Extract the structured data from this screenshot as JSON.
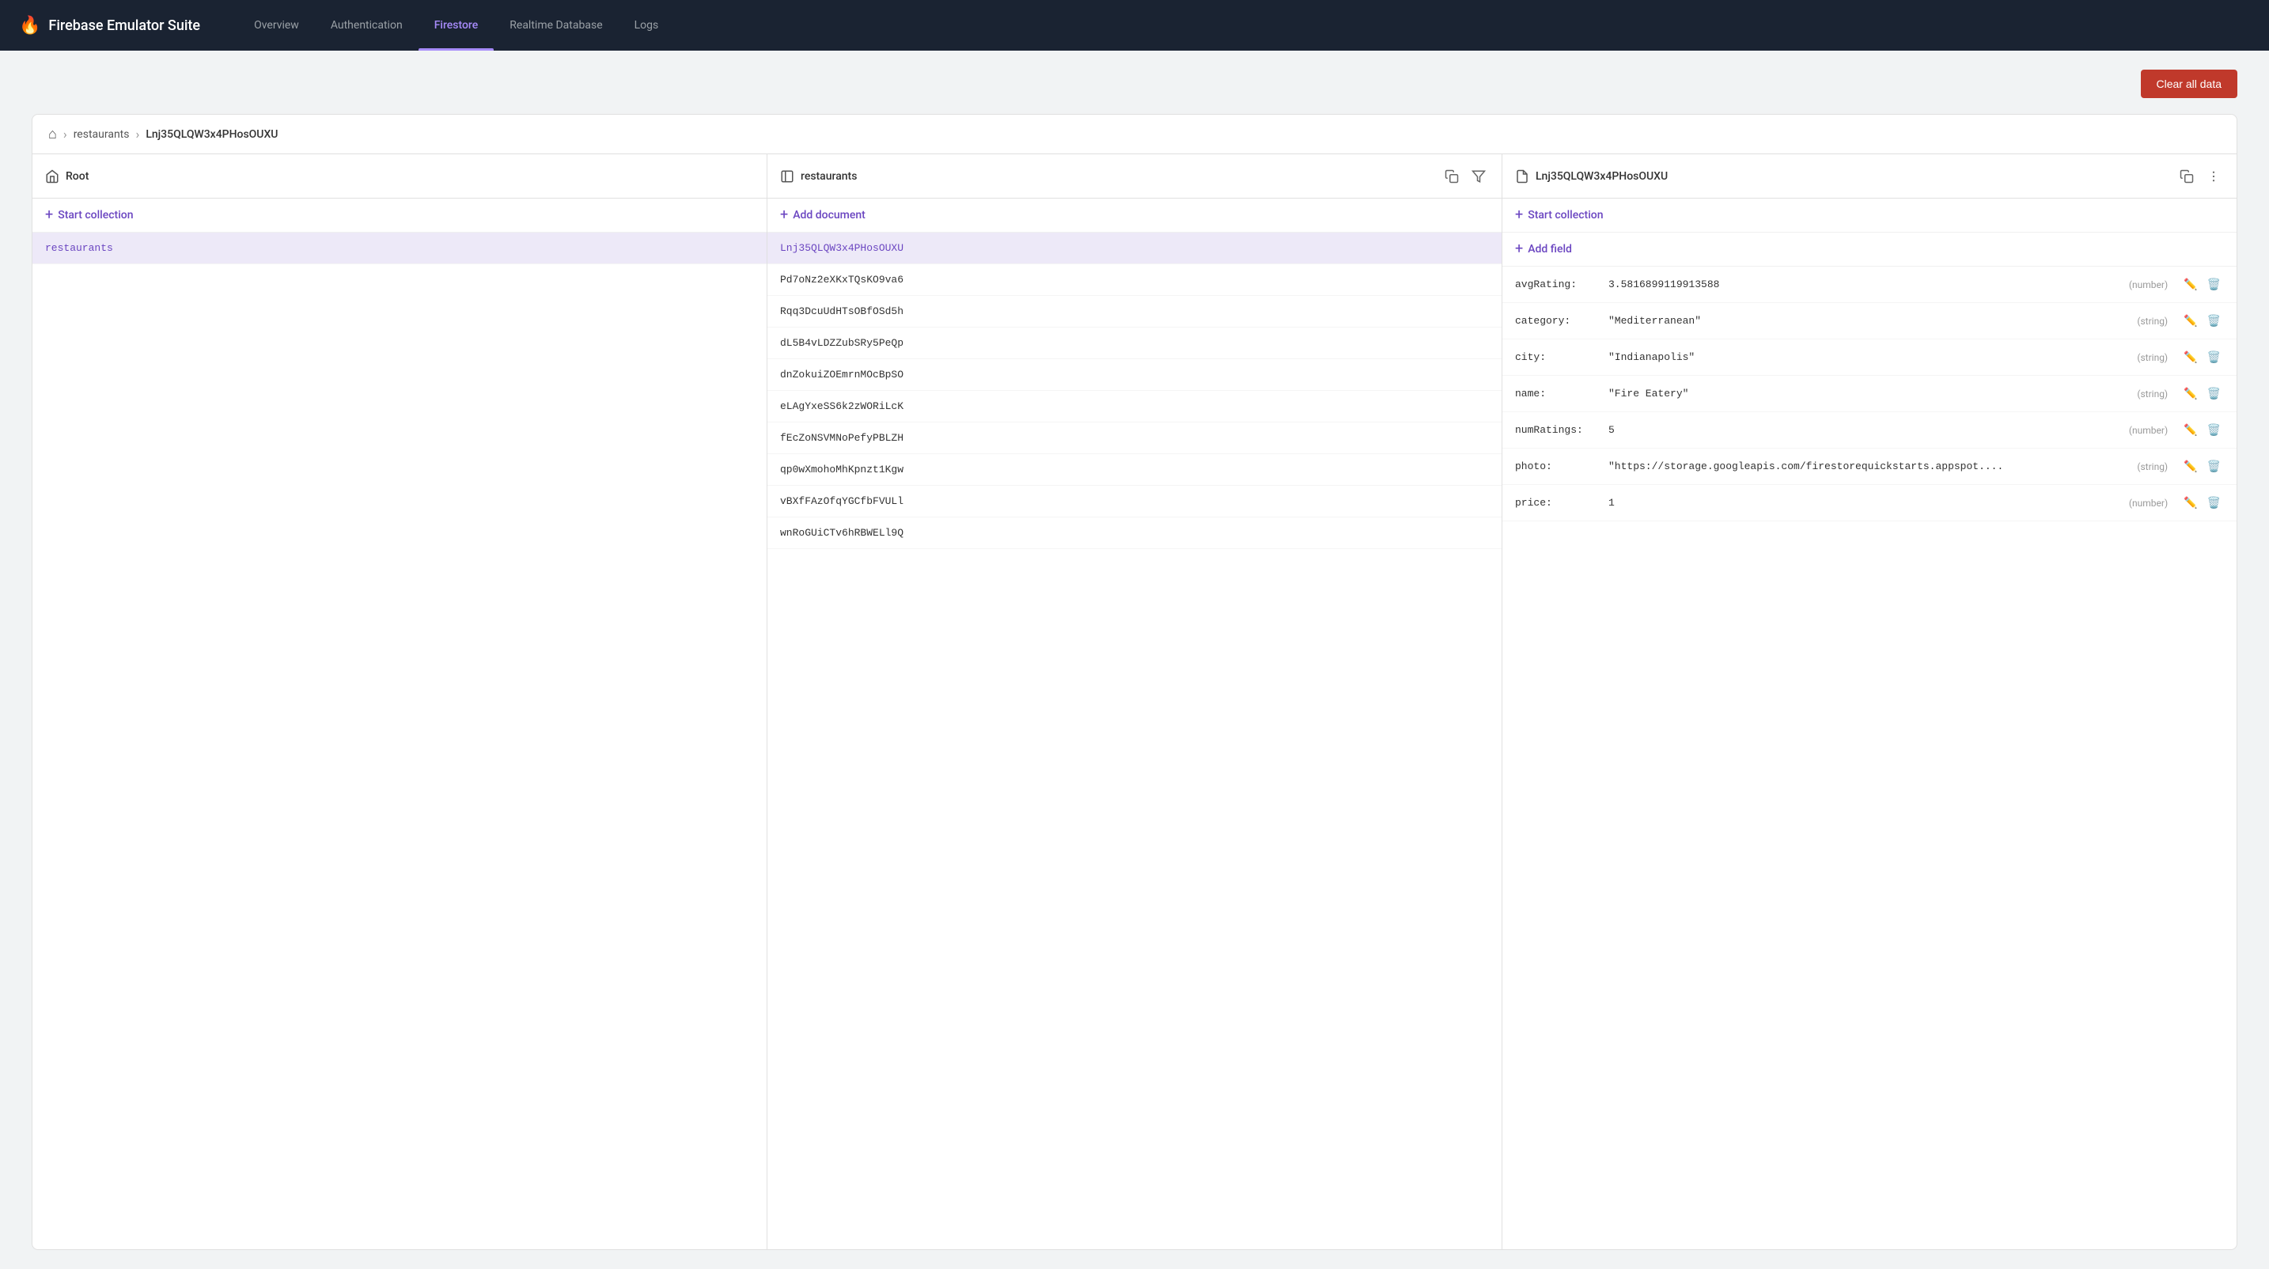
{
  "app": {
    "name": "Firebase Emulator Suite"
  },
  "nav": {
    "links": [
      {
        "id": "overview",
        "label": "Overview",
        "active": false
      },
      {
        "id": "authentication",
        "label": "Authentication",
        "active": false
      },
      {
        "id": "firestore",
        "label": "Firestore",
        "active": true
      },
      {
        "id": "realtime-database",
        "label": "Realtime Database",
        "active": false
      },
      {
        "id": "logs",
        "label": "Logs",
        "active": false
      }
    ]
  },
  "toolbar": {
    "clear_label": "Clear all data"
  },
  "breadcrumb": {
    "home_title": "🏠",
    "separator": "›",
    "parts": [
      "restaurants",
      "Lnj35QLQW3x4PHosOUXU"
    ]
  },
  "columns": {
    "root": {
      "title": "Root",
      "start_collection_label": "+ Start collection",
      "items": [
        {
          "id": "restaurants",
          "label": "restaurants",
          "active": true
        }
      ]
    },
    "restaurants": {
      "title": "restaurants",
      "add_document_label": "+ Add document",
      "items": [
        {
          "id": "Lnj35QLQW3x4PHosOUXU",
          "label": "Lnj35QLQW3x4PHosOUXU",
          "selected": true
        },
        {
          "id": "Pd7oNz2eXKxTQsKO9va6",
          "label": "Pd7oNz2eXKxTQsKO9va6"
        },
        {
          "id": "Rqq3DcuUdHTsOBfOSd5h",
          "label": "Rqq3DcuUdHTsOBfOSd5h"
        },
        {
          "id": "dL5B4vLDZZubSRy5PeQp",
          "label": "dL5B4vLDZZubSRy5PeQp"
        },
        {
          "id": "dnZokuiZOEmrnMOcBpSO",
          "label": "dnZokuiZOEmrnMOcBpSO"
        },
        {
          "id": "eLAgYxeSS6k2zWORiLcK",
          "label": "eLAgYxeSS6k2zWORiLcK"
        },
        {
          "id": "fEcZoNSVMNoPefyPBLZH",
          "label": "fEcZoNSVMNoPefyPBLZH"
        },
        {
          "id": "qp0wXmohoMhKpnzt1Kgw",
          "label": "qp0wXmohoMhKpnzt1Kgw"
        },
        {
          "id": "vBXfFAzOfqYGCfbFVULl",
          "label": "vBXfFAzOfqYGCfbFVULl"
        },
        {
          "id": "wnRoGUiCTv6hRBWELl9Q",
          "label": "wnRoGUiCTv6hRBWELl9Q"
        }
      ]
    },
    "document": {
      "title": "Lnj35QLQW3x4PHosOUXU",
      "start_collection_label": "+ Start collection",
      "add_field_label": "+ Add field",
      "fields": [
        {
          "key": "avgRating:",
          "value": "3.5816899119913588",
          "type": "(number)"
        },
        {
          "key": "category:",
          "value": "\"Mediterranean\"",
          "type": "(string)"
        },
        {
          "key": "city:",
          "value": "\"Indianapolis\"",
          "type": "(string)"
        },
        {
          "key": "name:",
          "value": "\"Fire Eatery\"",
          "type": "(string)"
        },
        {
          "key": "numRatings:",
          "value": "5",
          "type": "(number)"
        },
        {
          "key": "photo:",
          "value": "\"https://storage.googleapis.com/firestorequickstarts.appspot....",
          "type": "(string)"
        },
        {
          "key": "price:",
          "value": "1",
          "type": "(number)"
        }
      ]
    }
  }
}
